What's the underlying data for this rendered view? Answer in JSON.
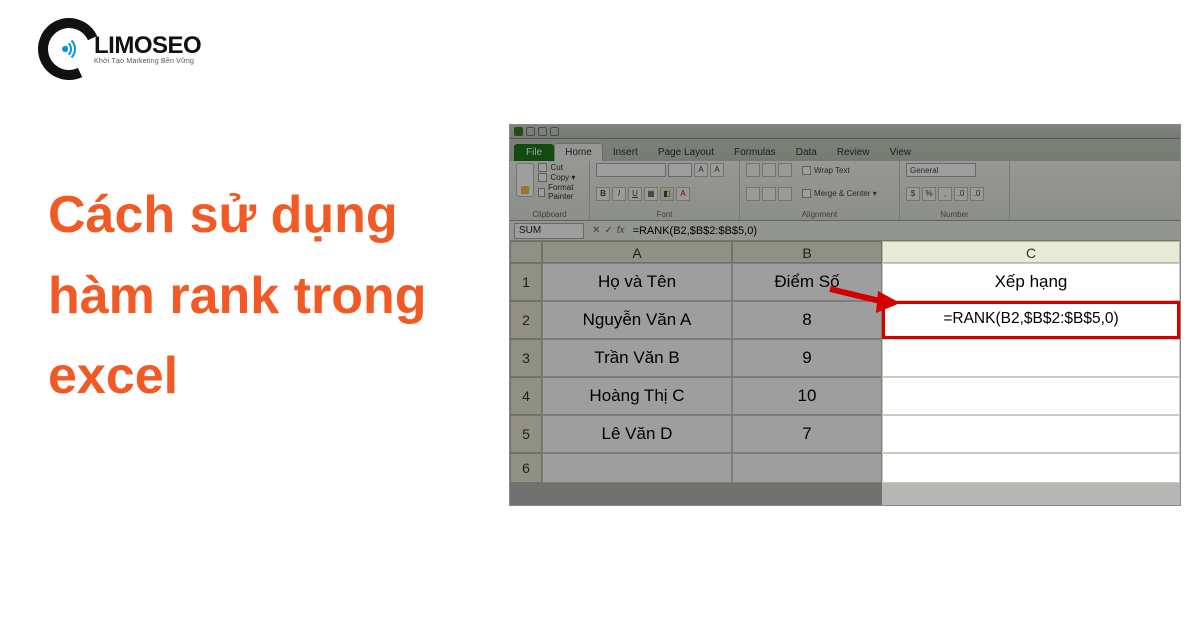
{
  "logo": {
    "brand": "LIMOSEO",
    "tagline": "Khởi Tạo Marketing Bền Vững"
  },
  "headline": "Cách sử dụng hàm rank trong excel",
  "excel": {
    "ribbon_tabs": {
      "file": "File",
      "home": "Home",
      "insert": "Insert",
      "page_layout": "Page Layout",
      "formulas": "Formulas",
      "data": "Data",
      "review": "Review",
      "view": "View"
    },
    "clipboard": {
      "paste": "Paste",
      "cut": "Cut",
      "copy": "Copy ▾",
      "format_painter": "Format Painter",
      "group": "Clipboard"
    },
    "font_group": "Font",
    "alignment": {
      "wrap": "Wrap Text",
      "merge": "Merge & Center ▾",
      "group": "Alignment"
    },
    "number": {
      "general": "General",
      "group": "Number"
    },
    "namebox": "SUM",
    "fx_cancel": "✕",
    "fx_enter": "✓",
    "fx_label": "fx",
    "formula_bar": "=RANK(B2,$B$2:$B$5,0)",
    "columns": {
      "a": "A",
      "b": "B",
      "c": "C"
    },
    "rows": [
      "1",
      "2",
      "3",
      "4",
      "5",
      "6"
    ],
    "data": {
      "header": {
        "a": "Họ và Tên",
        "b": "Điểm Số",
        "c": "Xếp hạng"
      },
      "r2": {
        "a": "Nguyễn Văn A",
        "b": "8",
        "c": "=RANK(B2,$B$2:$B$5,0)"
      },
      "r3": {
        "a": "Trần Văn B",
        "b": "9",
        "c": ""
      },
      "r4": {
        "a": "Hoàng Thị C",
        "b": "10",
        "c": ""
      },
      "r5": {
        "a": "Lê Văn D",
        "b": "7",
        "c": ""
      }
    }
  }
}
